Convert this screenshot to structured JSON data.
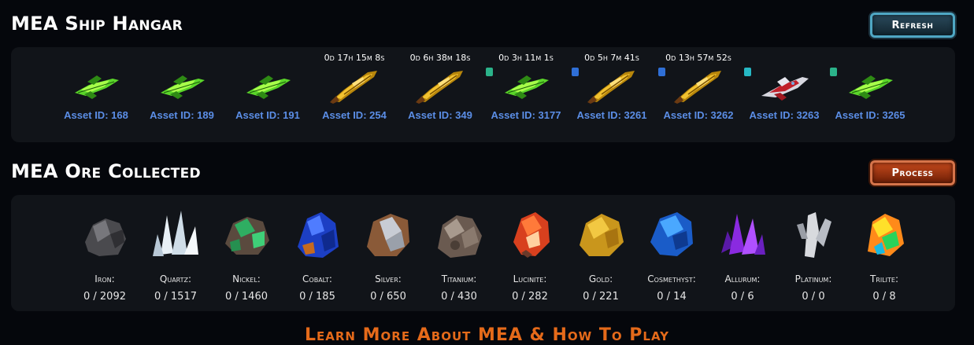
{
  "hangar": {
    "title": "MEA Ship Hangar",
    "refresh_label": "Refresh",
    "ships": [
      {
        "asset": "Asset ID: 168",
        "timer": "",
        "type": "green-ship",
        "badge": ""
      },
      {
        "asset": "Asset ID: 189",
        "timer": "",
        "type": "green-ship",
        "badge": ""
      },
      {
        "asset": "Asset ID: 191",
        "timer": "",
        "type": "green-ship",
        "badge": ""
      },
      {
        "asset": "Asset ID: 254",
        "timer": "0d 17h 15m 8s",
        "type": "gold-ship",
        "badge": ""
      },
      {
        "asset": "Asset ID: 349",
        "timer": "0d 6h 38m 18s",
        "type": "gold-ship",
        "badge": ""
      },
      {
        "asset": "Asset ID: 3177",
        "timer": "0d 3h 11m 1s",
        "type": "green-ship",
        "badge": "teal-badge"
      },
      {
        "asset": "Asset ID: 3261",
        "timer": "0d 5h 7m 41s",
        "type": "gold-ship",
        "badge": "blue-badge"
      },
      {
        "asset": "Asset ID: 3262",
        "timer": "0d 13h 57m 52s",
        "type": "gold-ship",
        "badge": "blue-badge"
      },
      {
        "asset": "Asset ID: 3263",
        "timer": "",
        "type": "red-ship",
        "badge": "cyan-badge"
      },
      {
        "asset": "Asset ID: 3265",
        "timer": "",
        "type": "green-ship",
        "badge": "teal-badge"
      }
    ]
  },
  "ore": {
    "title": "MEA Ore Collected",
    "process_label": "Process",
    "items": [
      {
        "name": "Iron:",
        "count": "0 / 2092",
        "icon": "iron-ore-icon"
      },
      {
        "name": "Quartz:",
        "count": "0 / 1517",
        "icon": "quartz-ore-icon"
      },
      {
        "name": "Nickel:",
        "count": "0 / 1460",
        "icon": "nickel-ore-icon"
      },
      {
        "name": "Cobalt:",
        "count": "0 / 185",
        "icon": "cobalt-ore-icon"
      },
      {
        "name": "Silver:",
        "count": "0 / 650",
        "icon": "silver-ore-icon"
      },
      {
        "name": "Titanium:",
        "count": "0 / 430",
        "icon": "titanium-ore-icon"
      },
      {
        "name": "Lucinite:",
        "count": "0 / 282",
        "icon": "lucinite-ore-icon"
      },
      {
        "name": "Gold:",
        "count": "0 / 221",
        "icon": "gold-ore-icon"
      },
      {
        "name": "Cosmethyst:",
        "count": "0 / 14",
        "icon": "cosmethyst-ore-icon"
      },
      {
        "name": "Allurum:",
        "count": "0 / 6",
        "icon": "allurum-ore-icon"
      },
      {
        "name": "Platinum:",
        "count": "0 / 0",
        "icon": "platinum-ore-icon"
      },
      {
        "name": "Trilite:",
        "count": "0 / 8",
        "icon": "trilite-ore-icon"
      }
    ]
  },
  "footer": {
    "text": "Learn More About MEA & How To Play"
  },
  "colors": {
    "asset_link": "#5b8ee6",
    "refresh_border": "#4fa7c4",
    "process_fill": "#c5491c",
    "footer_accent": "#e56a1a"
  }
}
